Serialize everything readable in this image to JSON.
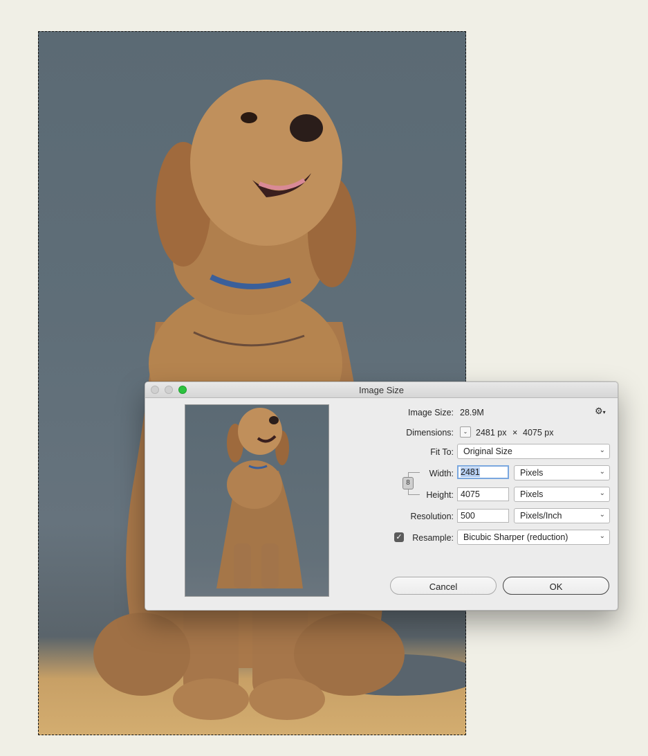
{
  "dialog": {
    "title": "Image Size",
    "image_size_label": "Image Size:",
    "image_size_value": "28.9M",
    "dimensions_label": "Dimensions:",
    "dimensions_width": "2481 px",
    "dimensions_times": "×",
    "dimensions_height": "4075 px",
    "fit_to_label": "Fit To:",
    "fit_to_value": "Original Size",
    "width_label": "Width:",
    "width_value": "2481",
    "width_unit": "Pixels",
    "height_label": "Height:",
    "height_value": "4075",
    "height_unit": "Pixels",
    "resolution_label": "Resolution:",
    "resolution_value": "500",
    "resolution_unit": "Pixels/Inch",
    "resample_label": "Resample:",
    "resample_checked": true,
    "resample_value": "Bicubic Sharper (reduction)",
    "cancel_label": "Cancel",
    "ok_label": "OK"
  },
  "icons": {
    "gear": "gear-icon",
    "chevron": "chevron-down-icon",
    "link": "chain-link-icon",
    "check": "checkmark-icon"
  }
}
